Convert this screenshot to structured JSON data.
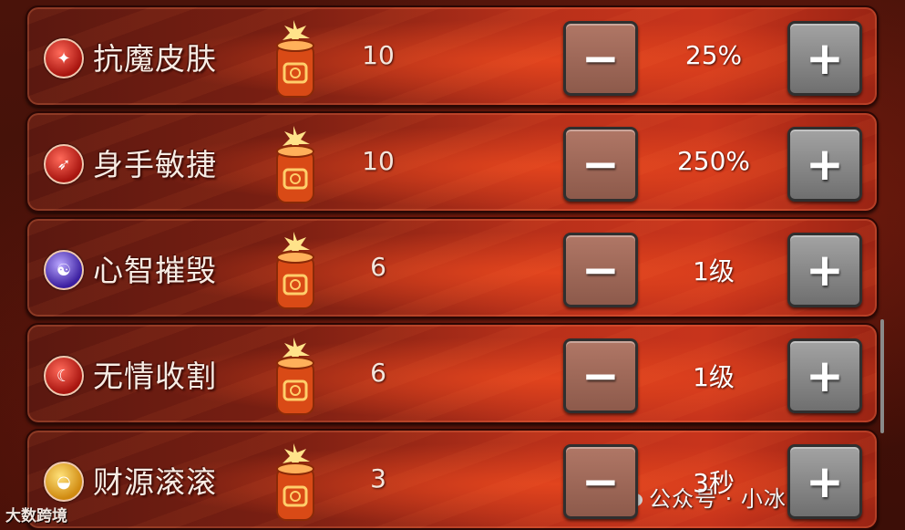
{
  "skills": [
    {
      "name": "抗魔皮肤",
      "cost": "10",
      "value": "25%",
      "icon": "shield-rune-icon",
      "icon_color": "red"
    },
    {
      "name": "身手敏捷",
      "cost": "10",
      "value": "250%",
      "icon": "boot-icon",
      "icon_color": "red"
    },
    {
      "name": "心智摧毁",
      "cost": "6",
      "value": "1级",
      "icon": "brain-icon",
      "icon_color": "purple"
    },
    {
      "name": "无情收割",
      "cost": "6",
      "value": "1级",
      "icon": "scythe-icon",
      "icon_color": "red"
    },
    {
      "name": "财源滚滚",
      "cost": "3",
      "value": "3秒",
      "icon": "gold-ingot-icon",
      "icon_color": "gold"
    }
  ],
  "buttons": {
    "minus": "−",
    "plus": "+"
  },
  "watermark": {
    "left": "大数跨境",
    "right": "公众号 · 小冰冰徒然"
  },
  "colors": {
    "row_red": "#c8341c",
    "minus_btn": "#9a6252",
    "plus_btn": "#8a8a8a"
  }
}
